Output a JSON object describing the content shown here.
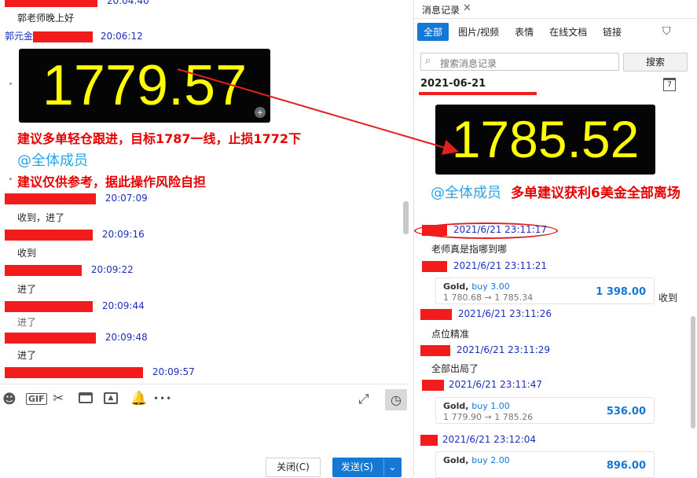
{
  "left": {
    "messages": [
      {
        "time": "20:04:40"
      },
      {
        "text": "郭老师晚上好"
      },
      {
        "sender": "郭元金",
        "time": "20:06:12"
      },
      {
        "time": "20:07:09"
      },
      {
        "text": "收到，进了"
      },
      {
        "time": "20:09:16"
      },
      {
        "text": "收到"
      },
      {
        "time": "20:09:22"
      },
      {
        "text": "进了"
      },
      {
        "time": "20:09:44"
      },
      {
        "text": "进了"
      },
      {
        "time": "20:09:48"
      },
      {
        "text": "进了"
      },
      {
        "time": "20:09:57"
      }
    ],
    "price_board": "1779.57",
    "annotation_1": "建议多单轻仓跟进，目标1787一线，止损1772下",
    "at_all": "@全体成员",
    "annotation_2": "建议仅供参考，据此操作风险自担",
    "toolbar_icons": [
      "emoji-icon",
      "gif-icon",
      "scissors-icon",
      "folder-icon",
      "image-icon",
      "bell-icon",
      "more-icon",
      "expand-icon",
      "history-icon"
    ],
    "gif_label": "GIF",
    "more_label": "•••",
    "close_button": "关闭(C)",
    "send_button": "发送(S)"
  },
  "right": {
    "panel_title": "消息记录",
    "tabs": [
      "全部",
      "图片/视频",
      "表情",
      "在线文档",
      "链接"
    ],
    "search_placeholder": "搜索消息记录",
    "search_button": "搜索",
    "date": "2021-06-21",
    "calendar_day": "7",
    "price_board": "1785.52",
    "at_all": "@全体成员",
    "annotation": "多单建议获利6美金全部离场",
    "entries": [
      {
        "time": "2021/6/21 23:11:17"
      },
      {
        "text": "老师真是指哪到哪"
      },
      {
        "time": "2021/6/21 23:11:21"
      },
      {
        "time": "2021/6/21 23:11:26"
      },
      {
        "text": "点位精准"
      },
      {
        "time": "2021/6/21 23:11:29"
      },
      {
        "text": "全部出局了"
      },
      {
        "time": "2021/6/21 23:11:47"
      },
      {
        "time": "2021/6/21 23:12:04"
      }
    ],
    "trade_cards": [
      {
        "symbol": "Gold,",
        "side": "buy 3.00",
        "prices": "1 780.68 → 1 785.34",
        "profit": "1 398.00"
      },
      {
        "symbol": "Gold,",
        "side": "buy 1.00",
        "prices": "1 779.90 → 1 785.26",
        "profit": "536.00"
      },
      {
        "symbol": "Gold,",
        "side": "buy 2.00",
        "prices": "",
        "profit": "896.00"
      }
    ],
    "side_text": "收到"
  },
  "colors": {
    "accent": "#1478d4",
    "annotation_red": "#e60000",
    "link_blue": "#1d2fb8",
    "board_yellow": "#ffff00"
  }
}
